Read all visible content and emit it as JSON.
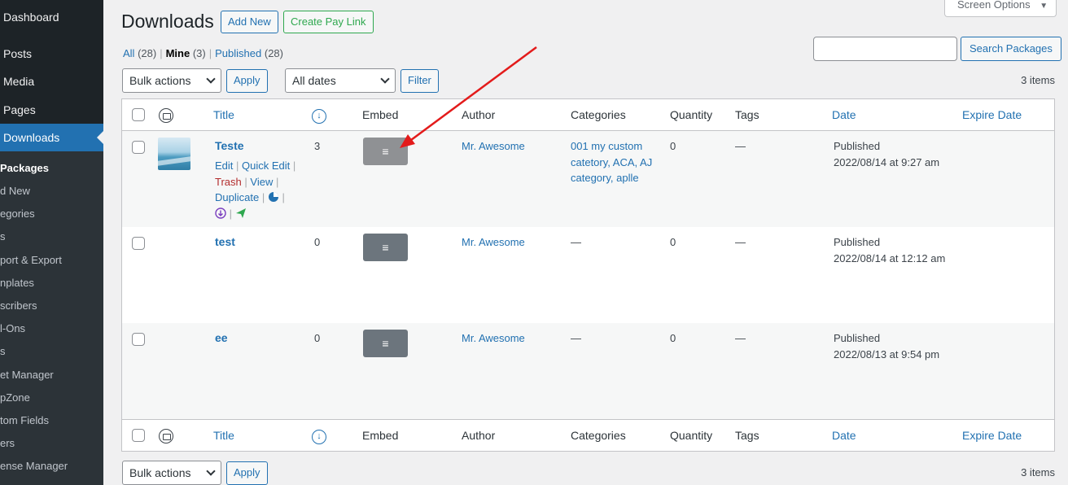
{
  "sidebar": {
    "dashboard": "Dashboard",
    "posts": "Posts",
    "media": "Media",
    "pages": "Pages",
    "downloads": "Downloads",
    "submenu": [
      "Packages",
      "d New",
      "egories",
      "s",
      "port & Export",
      "nplates",
      "scribers",
      "l-Ons",
      "s",
      "et Manager",
      "pZone",
      "tom Fields",
      "ers",
      "ense Manager"
    ]
  },
  "header": {
    "title": "Downloads",
    "add_new": "Add New",
    "create_pay_link": "Create Pay Link",
    "screen_options": "Screen Options"
  },
  "views": {
    "all": "All",
    "all_count": "(28)",
    "mine": "Mine",
    "mine_count": "(3)",
    "published": "Published",
    "published_count": "(28)",
    "separator": "|"
  },
  "search": {
    "value": "",
    "button": "Search Packages"
  },
  "tablenav": {
    "bulk_actions": "Bulk actions",
    "apply": "Apply",
    "all_dates": "All dates",
    "filter": "Filter",
    "items_count": "3 items"
  },
  "columns": {
    "title": "Title",
    "download_icon": "↓",
    "embed": "Embed",
    "author": "Author",
    "categories": "Categories",
    "quantity": "Quantity",
    "tags": "Tags",
    "date": "Date",
    "expire_date": "Expire Date"
  },
  "rows": [
    {
      "title": "Teste",
      "downloads": "3",
      "embed_icon": "≡",
      "author": "Mr. Awesome",
      "categories_line1": "001 my custom",
      "categories_line2": "catetory, ACA, AJ",
      "categories_line3": "category, aplle",
      "quantity": "0",
      "tags": "—",
      "status": "Published",
      "date": "2022/08/14 at 9:27 am",
      "actions": {
        "edit": "Edit",
        "quick_edit": "Quick Edit",
        "trash": "Trash",
        "view": "View",
        "duplicate": "Duplicate",
        "sep": "|"
      }
    },
    {
      "title": "test",
      "downloads": "0",
      "embed_icon": "≡",
      "author": "Mr. Awesome",
      "categories": "—",
      "quantity": "0",
      "tags": "—",
      "status": "Published",
      "date": "2022/08/14 at 12:12 am"
    },
    {
      "title": "ee",
      "downloads": "0",
      "embed_icon": "≡",
      "author": "Mr. Awesome",
      "categories": "—",
      "quantity": "0",
      "tags": "—",
      "status": "Published",
      "date": "2022/08/13 at 9:54 pm"
    }
  ],
  "colors": {
    "admin_blue": "#2271b1",
    "sidebar_bg": "#1d2327",
    "trash_red": "#b32d2e",
    "pay_link_green": "#2fa84f",
    "annotation_red": "#e31b1b"
  }
}
